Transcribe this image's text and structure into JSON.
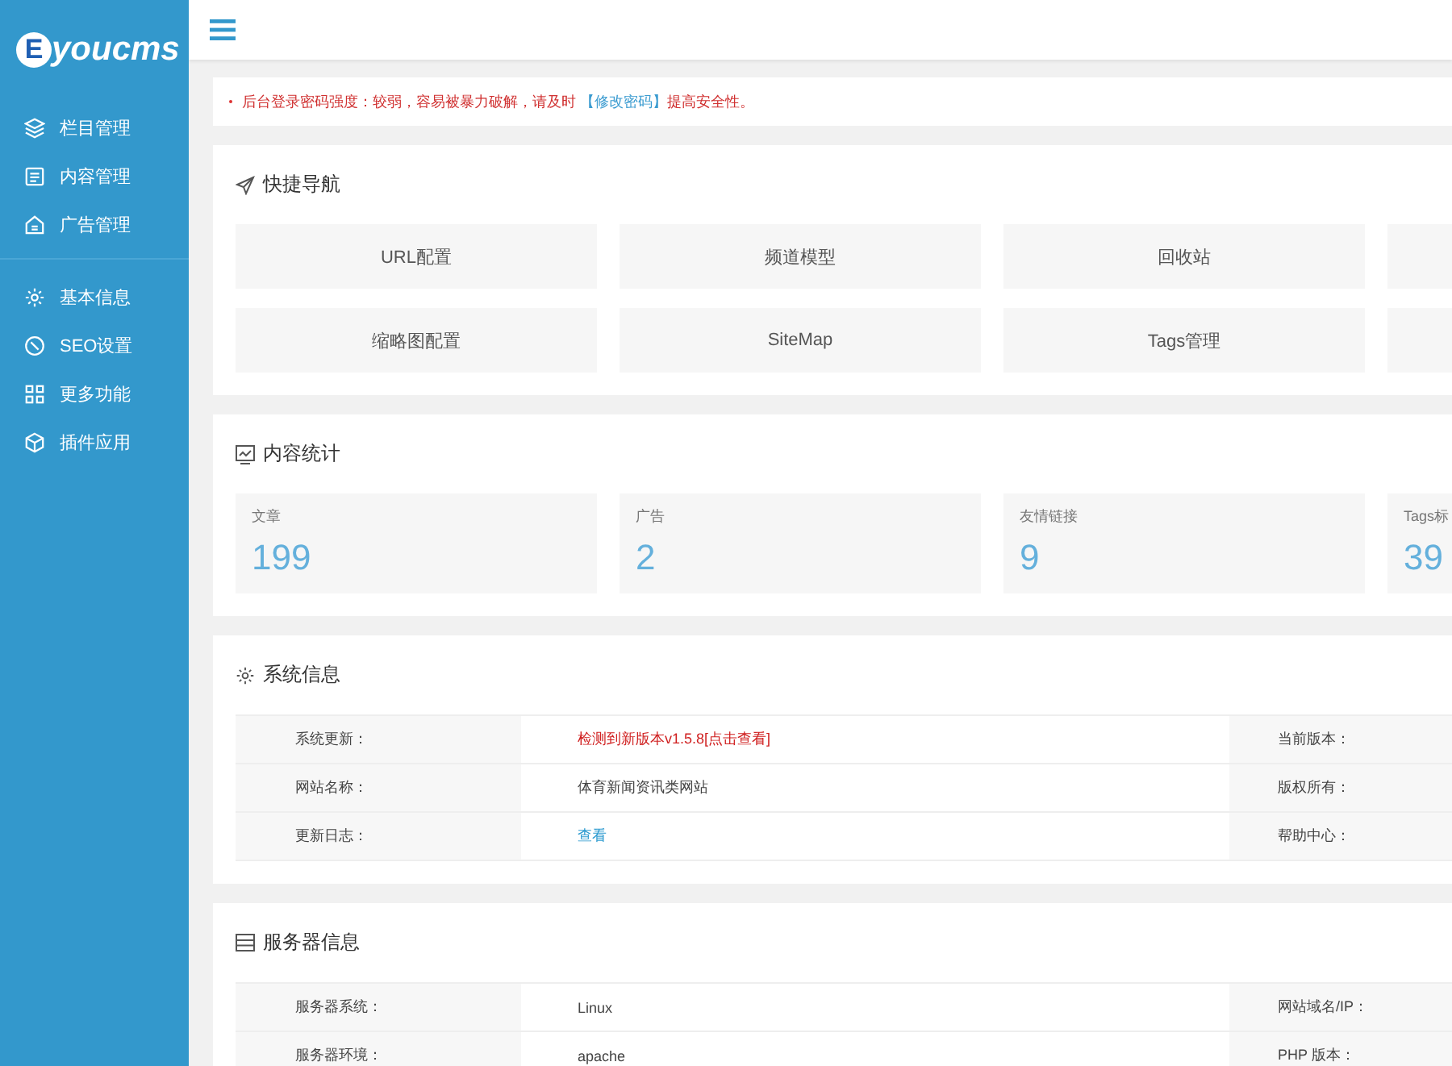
{
  "logo": {
    "mark": "E",
    "text": "youcms"
  },
  "sidebar": {
    "groups": [
      {
        "items": [
          {
            "label": "栏目管理"
          },
          {
            "label": "内容管理"
          },
          {
            "label": "广告管理"
          }
        ]
      },
      {
        "items": [
          {
            "label": "基本信息"
          },
          {
            "label": "SEO设置"
          },
          {
            "label": "更多功能"
          },
          {
            "label": "插件应用"
          }
        ]
      }
    ]
  },
  "notice": {
    "before": "后台登录密码强度：较弱，容易被暴力破解，请及时 ",
    "link": "【修改密码】",
    "after": "提高安全性。"
  },
  "quick_nav": {
    "title": "快捷导航",
    "tile_rows": [
      [
        "URL配置",
        "频道模型",
        "回收站"
      ],
      [
        "缩略图配置",
        "SiteMap",
        "Tags管理"
      ]
    ]
  },
  "stats": {
    "title": "内容统计",
    "cards": [
      {
        "label": "文章",
        "value": "199"
      },
      {
        "label": "广告",
        "value": "2"
      },
      {
        "label": "友情链接",
        "value": "9"
      },
      {
        "label": "Tags标",
        "value": "39"
      }
    ]
  },
  "system_info": {
    "title": "系统信息",
    "rows": [
      {
        "label": "系统更新：",
        "value": "检测到新版本v1.5.8[点击查看]",
        "kind": "alert",
        "label_2": "当前版本："
      },
      {
        "label": "网站名称：",
        "value": "体育新闻资讯类网站",
        "kind": "text",
        "label_2": "版权所有："
      },
      {
        "label": "更新日志：",
        "value": "查看",
        "kind": "link",
        "label_2": "帮助中心："
      }
    ]
  },
  "server_info": {
    "title": "服务器信息",
    "rows": [
      {
        "label": "服务器系统：",
        "value": "Linux",
        "kind": "text",
        "label_2": "网站域名/IP："
      },
      {
        "label": "服务器环境：",
        "value": "apache",
        "kind": "text",
        "label_2": "PHP 版本："
      }
    ]
  }
}
